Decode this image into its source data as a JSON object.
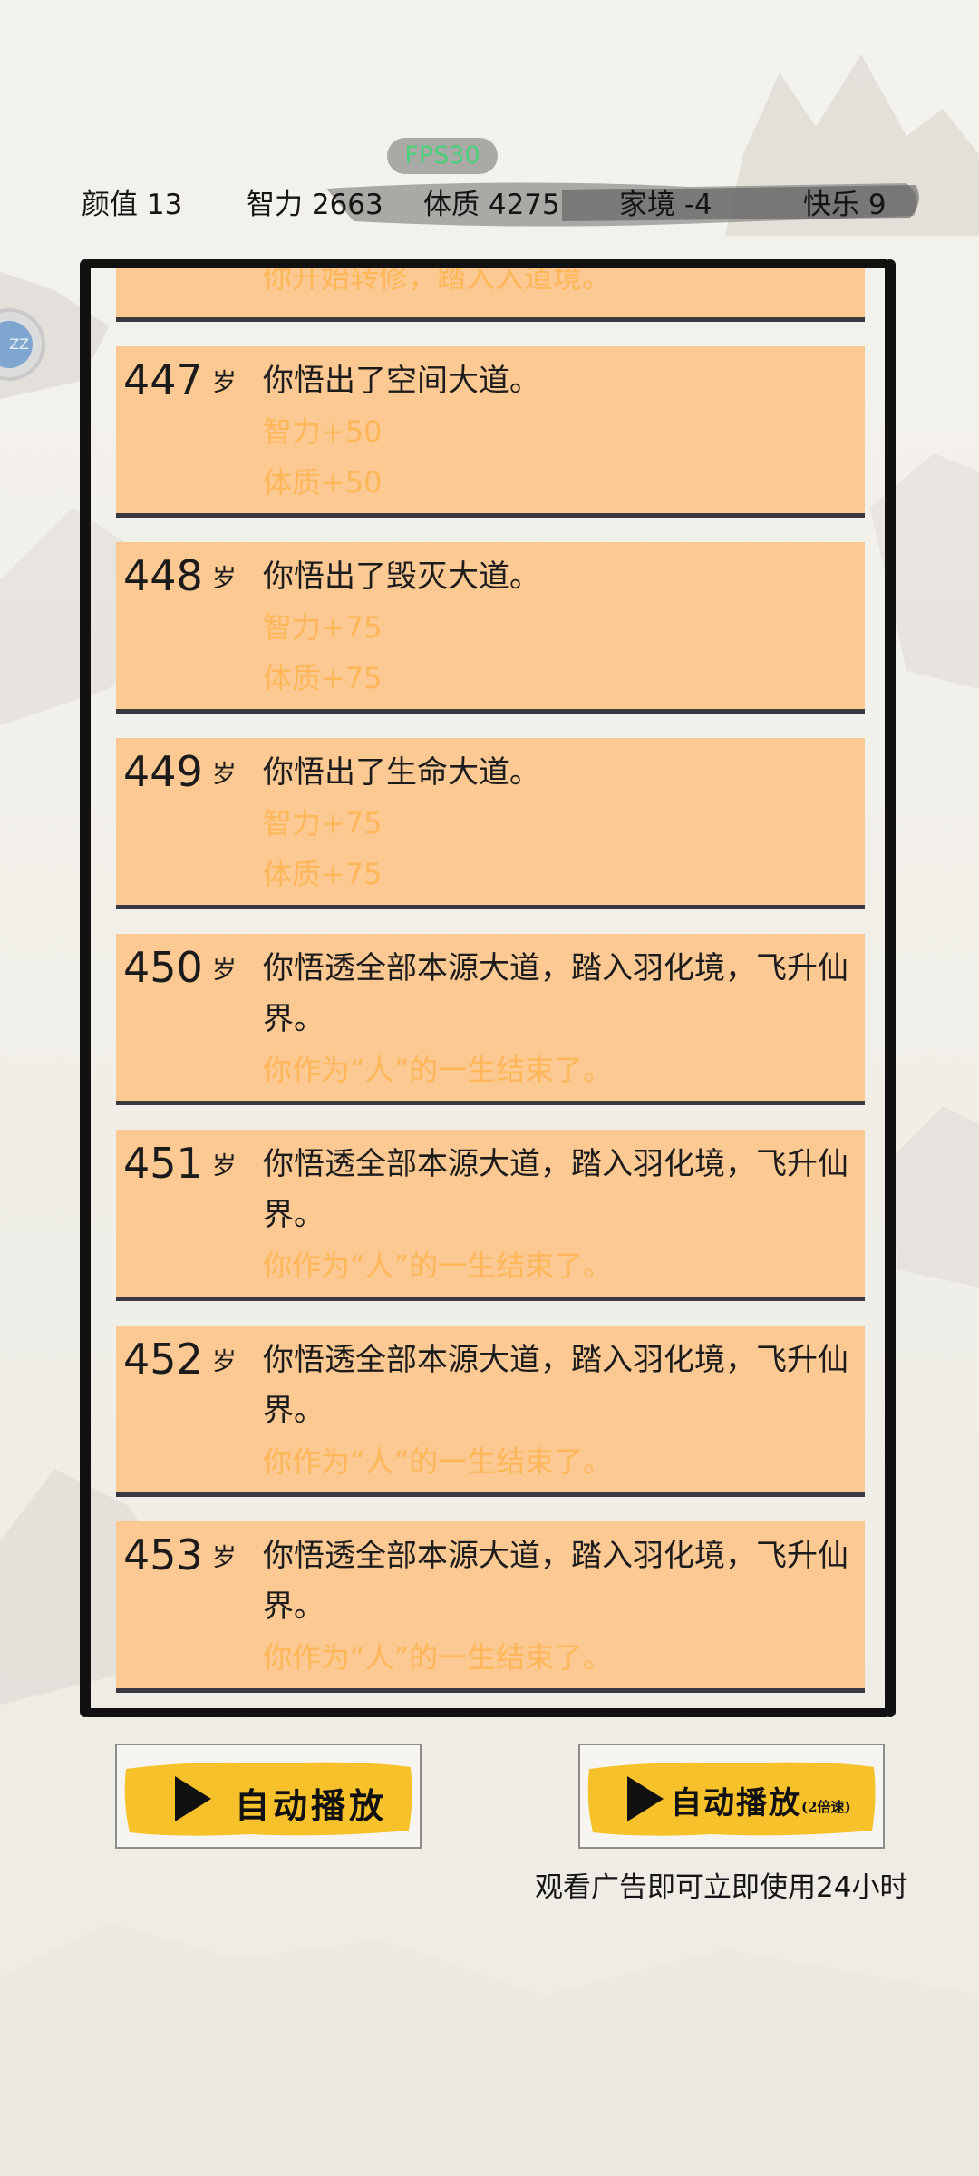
{
  "hud": {
    "fps": "FPS30",
    "stats": [
      {
        "label": "颜值 13"
      },
      {
        "label": "智力 2663"
      },
      {
        "label": "体质 4275"
      },
      {
        "label": "家境 -4"
      },
      {
        "label": "快乐 9"
      }
    ],
    "side_bubble_text": "ZZ"
  },
  "log": {
    "partial_top": "你开始转修，踏入入道境。",
    "age_unit": "岁",
    "entries": [
      {
        "age": "447",
        "text": "你悟出了空间大道。",
        "effects": [
          "智力+50",
          "体质+50"
        ]
      },
      {
        "age": "448",
        "text": "你悟出了毁灭大道。",
        "effects": [
          "智力+75",
          "体质+75"
        ]
      },
      {
        "age": "449",
        "text": "你悟出了生命大道。",
        "effects": [
          "智力+75",
          "体质+75"
        ]
      },
      {
        "age": "450",
        "text": "你悟透全部本源大道，踏入羽化境，飞升仙界。",
        "effects": [
          "你作为“人”的一生结束了。"
        ]
      },
      {
        "age": "451",
        "text": "你悟透全部本源大道，踏入羽化境，飞升仙界。",
        "effects": [
          "你作为“人”的一生结束了。"
        ]
      },
      {
        "age": "452",
        "text": "你悟透全部本源大道，踏入羽化境，飞升仙界。",
        "effects": [
          "你作为“人”的一生结束了。"
        ]
      },
      {
        "age": "453",
        "text": "你悟透全部本源大道，踏入羽化境，飞升仙界。",
        "effects": [
          "你作为“人”的一生结束了。"
        ]
      }
    ]
  },
  "controls": {
    "auto_play": "自动播放",
    "auto_play_2x": "自动播放",
    "auto_play_2x_suffix": "(2倍速)",
    "ad_note": "观看广告即可立即使用24小时"
  },
  "colors": {
    "entry_bg": "#fdc993",
    "effect_text": "#ffb656",
    "button_brush": "#f6c12a",
    "fps_text": "#4bd07a"
  }
}
